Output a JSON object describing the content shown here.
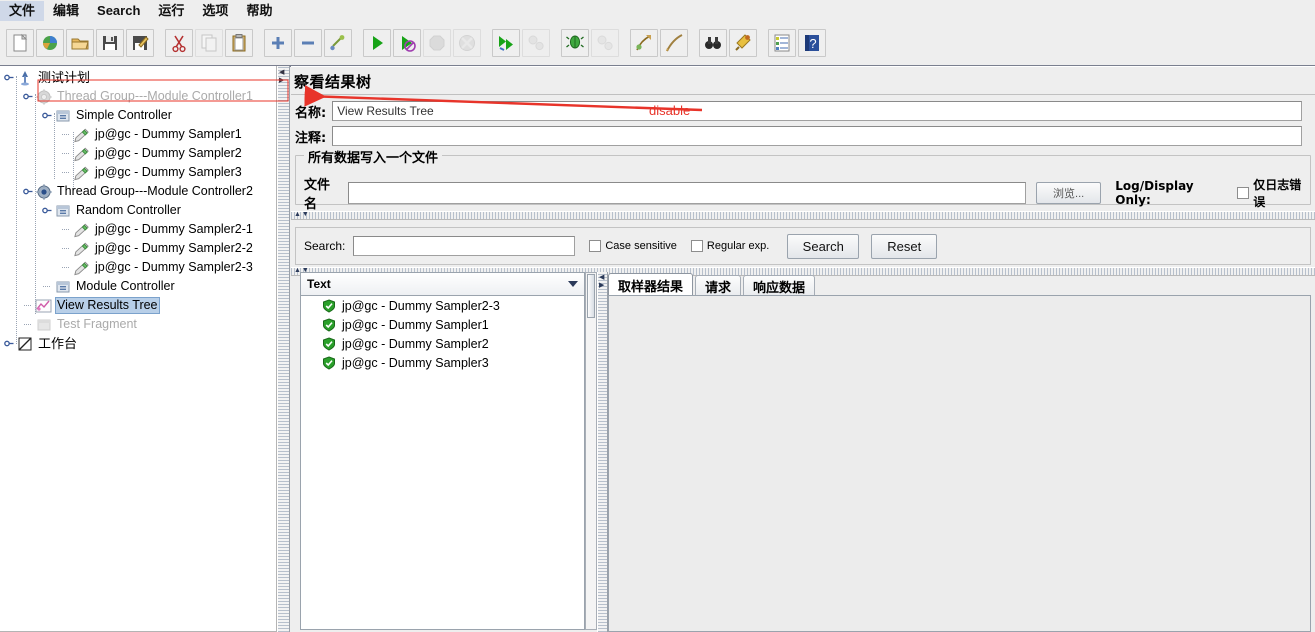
{
  "menu": {
    "items": [
      {
        "label": "文件",
        "name": "menu-file"
      },
      {
        "label": "编辑",
        "name": "menu-edit"
      },
      {
        "label": "Search",
        "name": "menu-search"
      },
      {
        "label": "运行",
        "name": "menu-run"
      },
      {
        "label": "选项",
        "name": "menu-options"
      },
      {
        "label": "帮助",
        "name": "menu-help"
      }
    ]
  },
  "toolbar": {
    "buttons": [
      {
        "icon": "new-file-icon",
        "enabled": true
      },
      {
        "icon": "templates-icon",
        "enabled": true
      },
      {
        "icon": "open-folder-icon",
        "enabled": true
      },
      {
        "icon": "save-icon",
        "enabled": true
      },
      {
        "icon": "save-as-icon",
        "enabled": true
      },
      {
        "icon": "cut-icon",
        "enabled": true
      },
      {
        "icon": "copy-icon",
        "enabled": true
      },
      {
        "icon": "paste-icon",
        "enabled": true
      },
      {
        "icon": "expand-all-icon",
        "enabled": true
      },
      {
        "icon": "collapse-all-icon",
        "enabled": true
      },
      {
        "icon": "toggle-icon",
        "enabled": true
      },
      {
        "icon": "start-icon",
        "enabled": true
      },
      {
        "icon": "start-no-pauses-icon",
        "enabled": true
      },
      {
        "icon": "stop-icon",
        "enabled": false
      },
      {
        "icon": "shutdown-icon",
        "enabled": false
      },
      {
        "icon": "remote-start-all-icon",
        "enabled": true
      },
      {
        "icon": "remote-stop-all-icon",
        "enabled": false
      },
      {
        "icon": "clear-icon",
        "enabled": true
      },
      {
        "icon": "clear-all-icon",
        "enabled": false
      },
      {
        "icon": "search-tree-icon",
        "enabled": true
      },
      {
        "icon": "reset-search-icon",
        "enabled": true
      },
      {
        "icon": "function-helper-icon",
        "enabled": true
      },
      {
        "icon": "help-icon",
        "enabled": true
      }
    ]
  },
  "tree": {
    "nodes": [
      {
        "label": "测试计划",
        "icon": "test-plan-icon",
        "depth": 0,
        "state": "normal",
        "expander": "expanded",
        "cn": true
      },
      {
        "label": "Thread Group---Module Controller1",
        "icon": "thread-group-icon",
        "depth": 1,
        "state": "disabled",
        "expander": "expanded"
      },
      {
        "label": "Simple Controller",
        "icon": "controller-icon",
        "depth": 2,
        "state": "normal",
        "expander": "expanded"
      },
      {
        "label": "jp@gc - Dummy Sampler1",
        "icon": "sampler-icon",
        "depth": 3,
        "state": "normal",
        "expander": "leaf"
      },
      {
        "label": "jp@gc - Dummy Sampler2",
        "icon": "sampler-icon",
        "depth": 3,
        "state": "normal",
        "expander": "leaf"
      },
      {
        "label": "jp@gc - Dummy Sampler3",
        "icon": "sampler-icon",
        "depth": 3,
        "state": "normal",
        "expander": "leaf"
      },
      {
        "label": "Thread Group---Module Controller2",
        "icon": "thread-group-icon",
        "depth": 1,
        "state": "normal",
        "expander": "expanded"
      },
      {
        "label": "Random Controller",
        "icon": "controller-icon",
        "depth": 2,
        "state": "normal",
        "expander": "expanded"
      },
      {
        "label": "jp@gc - Dummy Sampler2-1",
        "icon": "sampler-icon",
        "depth": 3,
        "state": "normal",
        "expander": "leaf"
      },
      {
        "label": "jp@gc - Dummy Sampler2-2",
        "icon": "sampler-icon",
        "depth": 3,
        "state": "normal",
        "expander": "leaf"
      },
      {
        "label": "jp@gc - Dummy Sampler2-3",
        "icon": "sampler-icon",
        "depth": 3,
        "state": "normal",
        "expander": "leaf"
      },
      {
        "label": "Module Controller",
        "icon": "controller-icon",
        "depth": 2,
        "state": "normal",
        "expander": "leaf"
      },
      {
        "label": "View Results Tree",
        "icon": "view-results-tree-icon",
        "depth": 1,
        "state": "selected",
        "expander": "leaf"
      },
      {
        "label": "Test Fragment",
        "icon": "test-fragment-icon",
        "depth": 1,
        "state": "disabled",
        "expander": "leaf"
      },
      {
        "label": "工作台",
        "icon": "workbench-icon",
        "depth": 0,
        "state": "normal",
        "expander": "collapsed",
        "cn": true
      }
    ]
  },
  "panel": {
    "title": "察看结果树",
    "name_label": "名称:",
    "name_value": "View Results Tree",
    "comment_label": "注释:",
    "comment_value": "",
    "file_group_title": "所有数据写入一个文件",
    "filename_label": "文件名",
    "filename_value": "",
    "browse_label": "浏览...",
    "log_display_label": "Log/Display Only:",
    "errors_only_label": "仅日志错误",
    "errors_only_checked": false
  },
  "search": {
    "label": "Search:",
    "value": "",
    "case_sensitive_label": "Case sensitive",
    "case_sensitive_checked": false,
    "regex_label": "Regular exp.",
    "regex_checked": false,
    "search_button": "Search",
    "reset_button": "Reset"
  },
  "results": {
    "renderer_selected": "Text",
    "items": [
      {
        "label": "jp@gc - Dummy Sampler2-3",
        "status": "success"
      },
      {
        "label": "jp@gc - Dummy Sampler1",
        "status": "success"
      },
      {
        "label": "jp@gc - Dummy Sampler2",
        "status": "success"
      },
      {
        "label": "jp@gc - Dummy Sampler3",
        "status": "success"
      }
    ],
    "tabs": [
      {
        "label": "取样器结果",
        "active": true
      },
      {
        "label": "请求",
        "active": false
      },
      {
        "label": "响应数据",
        "active": false
      }
    ]
  },
  "annotation": {
    "text": "disable",
    "color": "#e8342a"
  }
}
